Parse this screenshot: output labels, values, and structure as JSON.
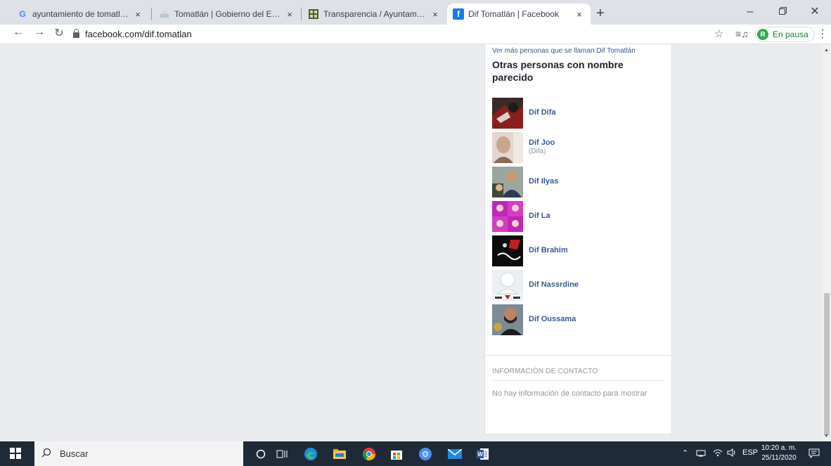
{
  "browser": {
    "tabs": [
      {
        "title": "ayuntamiento de tomatlán jalisco",
        "icon": "google-g-icon",
        "active": false
      },
      {
        "title": "Tomatlán | Gobierno del Estado de Jalisco",
        "icon": "jalisco-icon",
        "active": false
      },
      {
        "title": "Transparencia / Ayuntamiento de Tomatlán",
        "icon": "transparencia-icon",
        "active": false
      },
      {
        "title": "Dif Tomatlán | Facebook",
        "icon": "facebook-icon",
        "active": true
      }
    ],
    "close_glyph": "×",
    "new_tab_glyph": "+",
    "url": "facebook.com/dif.tomatlan",
    "profile_initial": "R",
    "profile_status": "En pausa"
  },
  "page": {
    "see_more_link": "Ver más personas que se llaman Dif Tomatlán",
    "others_title": "Otras personas con nombre parecido",
    "people": [
      {
        "name": "Dif Difa",
        "sub": ""
      },
      {
        "name": "Dif Joo",
        "sub": "(Difa)"
      },
      {
        "name": "Dif Ilyas",
        "sub": ""
      },
      {
        "name": "Dif La",
        "sub": ""
      },
      {
        "name": "Dif Brahim",
        "sub": ""
      },
      {
        "name": "Dif Nassrdine",
        "sub": ""
      },
      {
        "name": "Dif Oussama",
        "sub": ""
      }
    ],
    "contact_title": "INFORMACIÓN DE CONTACTO",
    "contact_empty": "No hay información de contacto para mostrar"
  },
  "taskbar": {
    "search_placeholder": "Buscar",
    "tray_lang": "ESP",
    "time": "10:20 a. m.",
    "date": "25/11/2020"
  },
  "colors": {
    "facebook_blue": "#385898",
    "page_bg": "#e9ebee",
    "taskbar_bg": "#1f2a38"
  }
}
